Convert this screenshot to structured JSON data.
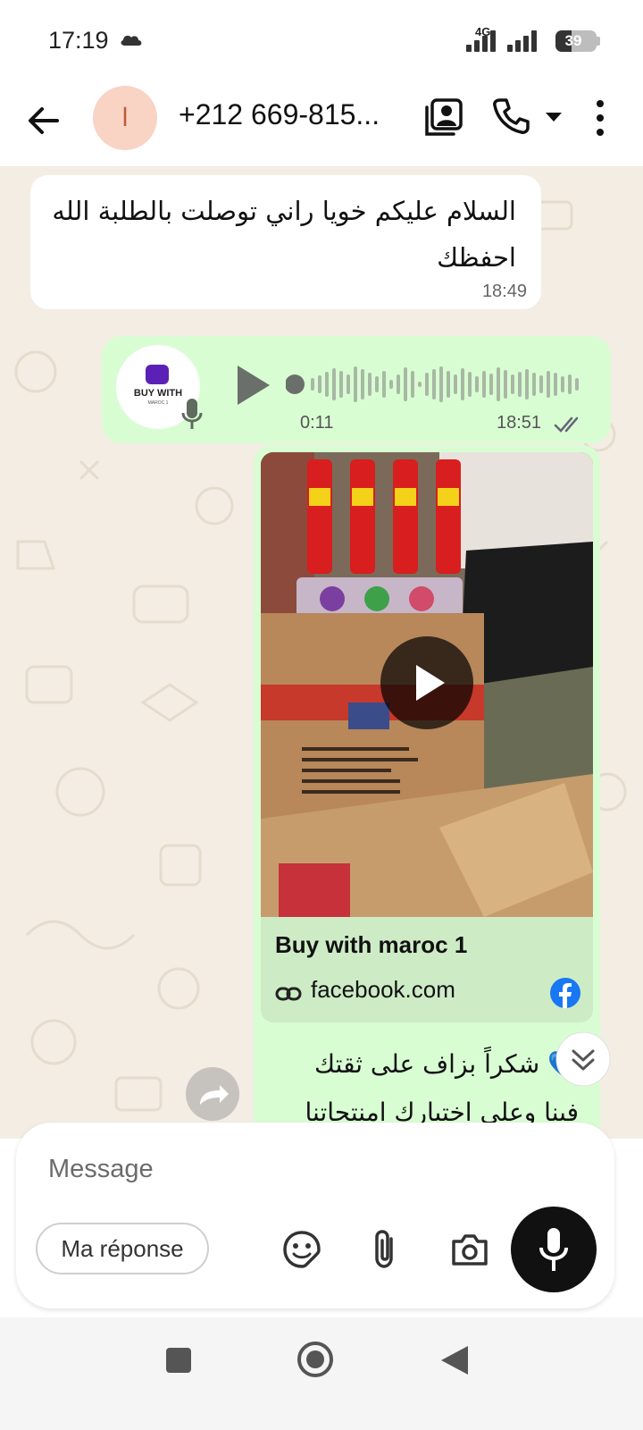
{
  "status_bar": {
    "time": "17:19",
    "network": "4G",
    "battery": "39",
    "battery_fraction": 0.39,
    "icons": [
      "cloud-icon",
      "signal-icon",
      "battery-icon"
    ]
  },
  "header": {
    "avatar_initial": "ا",
    "contact_name": "+212 669-815...",
    "icons": [
      "back-arrow-icon",
      "contact-card-icon",
      "phone-icon",
      "chevron-down-icon",
      "more-vertical-icon"
    ]
  },
  "messages": {
    "incoming_text": "السلام عليكم خويا راني توصلت بالطلبة الله احفظك",
    "incoming_time": "18:49",
    "voice": {
      "avatar_brand": "BUY WITH",
      "avatar_brand_sub": "MAROC 1",
      "duration": "0:11",
      "time": "18:51",
      "status": "double-tick-icon"
    },
    "link": {
      "title": "Buy with maroc 1",
      "domain": "facebook.com",
      "source_icon": "facebook-icon",
      "caption_line1": "💙 شكراً بزاف على ثقتك",
      "caption_line2": "فينا وعلى اختيارك امنتجاتنا"
    }
  },
  "composer": {
    "placeholder": "Message",
    "reply_chip": "Ma réponse",
    "icons": [
      "sticker-icon",
      "attach-icon",
      "camera-icon",
      "mic-icon"
    ]
  },
  "colors": {
    "outgoing_bubble": "#d9fdd3",
    "incoming_bubble": "#ffffff",
    "chat_background": "#f3ede4",
    "link_preview": "#cdecc6",
    "facebook_blue": "#1877f2"
  }
}
